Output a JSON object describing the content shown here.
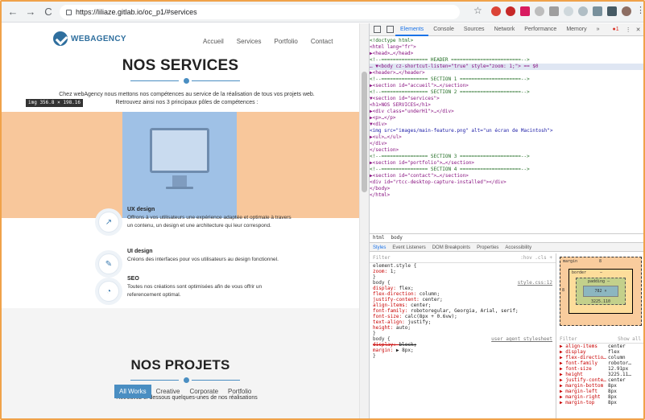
{
  "browser": {
    "url": "https://liliaze.gitlab.io/oc_p1/#services",
    "back": "←",
    "forward": "→",
    "reload": "C",
    "colors": {
      "ext1": "#db4437",
      "ext2": "#db4437",
      "ext3": "#9c27b0"
    }
  },
  "site": {
    "logo_text": "WEBAGENCY",
    "menu": [
      "Accueil",
      "Services",
      "Portfolio",
      "Contact"
    ],
    "services_title": "NOS SERVICES",
    "intro_line1": "Chez webAgency nous mettons nos compétences au service de la réalisation de tous vos projets web.",
    "intro_line2": "Retrouvez ainsi nos 3 principaux pôles de compétences :",
    "image_label": "img  356.8 × 198.16",
    "services": [
      {
        "icon": "chart-icon",
        "glyph": "↗",
        "title": "UX design",
        "desc": "Offrons à vos utilisateurs une expérience adaptée et optimale à travers un contenu, un design et une architecture qui leur correspond."
      },
      {
        "icon": "ui-icon",
        "glyph": "✎",
        "title": "UI design",
        "desc": "Créons des interfaces pour vos utilisateurs au design fonctionnel."
      },
      {
        "icon": "seo-icon",
        "glyph": "◔",
        "title": "SEO",
        "desc": "Toutes nos créations sont optimisées afin de vous offrir un referencement optimal."
      }
    ],
    "projects_title": "NOS PROJETS",
    "projects_intro": "Retrouvez ci-dessous quelques-unes de nos réalisations",
    "filters": [
      "All Works",
      "Creative",
      "Corporate",
      "Portfolio"
    ],
    "accent": "#4a8ec2",
    "band_color": "#f8c79b"
  },
  "devtools": {
    "tabs": [
      "Elements",
      "Console",
      "Sources",
      "Network",
      "Performance",
      "Memory",
      "»"
    ],
    "error_badge": "●1",
    "dom_lines": [
      {
        "text": "<!doctype html>",
        "cls": "cmt"
      },
      {
        "text": "<html lang=\"fr\">",
        "cls": "tag"
      },
      {
        "text": "  ▶<head>…</head>",
        "cls": "tag"
      },
      {
        "text": "    <!--================ HEADER ========================-->",
        "cls": "cmt"
      },
      {
        "text": "… ▼<body cz-shortcut-listen=\"true\" style=\"zoom: 1;\"> == $0",
        "cls": "tag",
        "sel": true
      },
      {
        "text": "    ▶<header>…</header>",
        "cls": "tag"
      },
      {
        "text": "    <!--================ SECTION 1 =====================-->",
        "cls": "cmt"
      },
      {
        "text": "    ▶<section id=\"accueil\">…</section>",
        "cls": "tag"
      },
      {
        "text": "    <!--================ SECTION 2 =====================-->",
        "cls": "cmt"
      },
      {
        "text": "    ▼<section id=\"services\">",
        "cls": "tag"
      },
      {
        "text": "        <h1>NOS SERVICES</h1>",
        "cls": "tag"
      },
      {
        "text": "      ▶<div class=\"underH1\">…</div>",
        "cls": "tag"
      },
      {
        "text": "      ▶<p>…</p>",
        "cls": "tag"
      },
      {
        "text": "      ▼<div>",
        "cls": "tag"
      },
      {
        "text": "          <img src=\"images/main-feature.png\" alt=\"un écran de Macintosh\">",
        "cls": "tag",
        "hl": true
      },
      {
        "text": "        ▶<ul>…</ul>",
        "cls": "tag"
      },
      {
        "text": "        </div>",
        "cls": "tag"
      },
      {
        "text": "      </section>",
        "cls": "tag"
      },
      {
        "text": "    <!--================ SECTION 3 =====================-->",
        "cls": "cmt"
      },
      {
        "text": "    ▶<section id=\"portfolio\">…</section>",
        "cls": "tag"
      },
      {
        "text": "    <!--================ SECTION 4 =====================-->",
        "cls": "cmt"
      },
      {
        "text": "    ▶<section id=\"contact\">…</section>",
        "cls": "tag"
      },
      {
        "text": "      <div id=\"rtcc-desktop-capture-installed\"></div>",
        "cls": "tag"
      },
      {
        "text": "    </body>",
        "cls": "tag"
      },
      {
        "text": "</html>",
        "cls": "tag"
      }
    ],
    "crumbs": [
      "html",
      "body"
    ],
    "subtabs": [
      "Styles",
      "Event Listeners",
      "DOM Breakpoints",
      "Properties",
      "Accessibility"
    ],
    "filter_placeholder": "Filter",
    "hov_cls": ":hov  .cls  +",
    "styles": [
      {
        "sel": "element.style {",
        "src": ""
      },
      {
        "prop": "zoom",
        "val": "1;"
      },
      {
        "end": "}"
      },
      {
        "sel": "body {",
        "src": "style.css:12"
      },
      {
        "prop": "display",
        "val": "flex;"
      },
      {
        "prop": "flex-direction",
        "val": "column;"
      },
      {
        "prop": "justify-content",
        "val": "center;"
      },
      {
        "prop": "align-items",
        "val": "center;"
      },
      {
        "prop": "font-family",
        "val": "robotoregular, Georgia, Arial, serif;"
      },
      {
        "prop": "font-size",
        "val": "calc(8px + 0.6vw);"
      },
      {
        "prop": "text-align",
        "val": "justify;"
      },
      {
        "prop": "height",
        "val": "auto;"
      },
      {
        "end": "}"
      },
      {
        "sel": "body {",
        "src": "user agent stylesheet"
      },
      {
        "prop": "display",
        "val": "block;",
        "strike": true
      },
      {
        "prop": "margin",
        "val": "▶ 8px;"
      },
      {
        "end": "}"
      }
    ],
    "box": {
      "margin": "margin",
      "margin_val": "8",
      "border": "border",
      "border_val": "–",
      "padding": "padding –",
      "content": "782 × 3225.110",
      "side": "8"
    },
    "computed_filter": "Filter",
    "show_all": "Show all",
    "computed": [
      {
        "k": "▶ align-items",
        "v": "center"
      },
      {
        "k": "▶ display",
        "v": "flex"
      },
      {
        "k": "▶ flex-directio…",
        "v": "column"
      },
      {
        "k": "▶ font-family",
        "v": "robotor…"
      },
      {
        "k": "▶ font-size",
        "v": "12.91px"
      },
      {
        "k": "▶ height",
        "v": "3225.11…"
      },
      {
        "k": "▶ justify-conte…",
        "v": "center"
      },
      {
        "k": "▶ margin-bottom",
        "v": "8px"
      },
      {
        "k": "▶ margin-left",
        "v": "8px"
      },
      {
        "k": "▶ margin-right",
        "v": "8px"
      },
      {
        "k": "▶ margin-top",
        "v": "8px"
      }
    ]
  }
}
